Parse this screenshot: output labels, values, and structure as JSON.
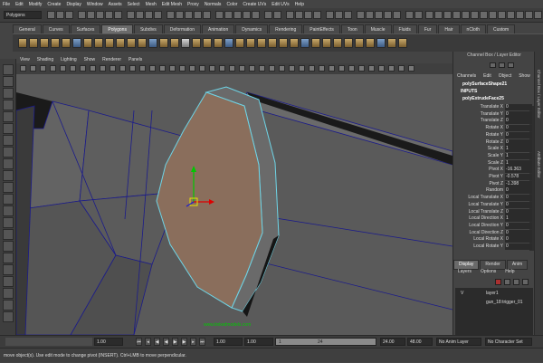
{
  "menubar": {
    "items": [
      "File",
      "Edit",
      "Modify",
      "Create",
      "Display",
      "Window",
      "Assets",
      "Select",
      "Mesh",
      "Edit Mesh",
      "Proxy",
      "Normals",
      "Color",
      "Create UVs",
      "Edit UVs",
      "Help"
    ]
  },
  "statusline": {
    "mode": "Polygons"
  },
  "shelf": {
    "tabs": [
      "General",
      "Curves",
      "Surfaces",
      "Polygons",
      "Subdivs",
      "Deformation",
      "Animation",
      "Dynamics",
      "Rendering",
      "PaintEffects",
      "Toon",
      "Muscle",
      "Fluids",
      "Fur",
      "Hair",
      "nCloth",
      "Custom"
    ],
    "active_tab": "Polygons"
  },
  "viewport": {
    "menu": [
      "View",
      "Shading",
      "Lighting",
      "Show",
      "Renderer",
      "Panels"
    ],
    "watermark": "www.tinkedmodels.com"
  },
  "channel_box": {
    "title": "Channel Box / Layer Editor",
    "menu": [
      "Channels",
      "Edit",
      "Object",
      "Show"
    ],
    "object_name": "polySurfaceShape21",
    "inputs_label": "INPUTS",
    "node_name": "polyExtrudeFace25",
    "attributes": [
      {
        "label": "Translate X",
        "value": "0"
      },
      {
        "label": "Translate Y",
        "value": "0"
      },
      {
        "label": "Translate Z",
        "value": "0"
      },
      {
        "label": "Rotate X",
        "value": "0"
      },
      {
        "label": "Rotate Y",
        "value": "0"
      },
      {
        "label": "Rotate Z",
        "value": "0"
      },
      {
        "label": "Scale X",
        "value": "1"
      },
      {
        "label": "Scale Y",
        "value": "1"
      },
      {
        "label": "Scale Z",
        "value": "1"
      },
      {
        "label": "Pivot X",
        "value": "-16.363"
      },
      {
        "label": "Pivot Y",
        "value": "-0.578"
      },
      {
        "label": "Pivot Z",
        "value": "-1.398"
      },
      {
        "label": "Random",
        "value": "0"
      },
      {
        "label": "Local Translate X",
        "value": "0"
      },
      {
        "label": "Local Translate Y",
        "value": "0"
      },
      {
        "label": "Local Translate Z",
        "value": "0"
      },
      {
        "label": "Local Direction X",
        "value": "1"
      },
      {
        "label": "Local Direction Y",
        "value": "0"
      },
      {
        "label": "Local Direction Z",
        "value": "0"
      },
      {
        "label": "Local Rotate X",
        "value": "0"
      },
      {
        "label": "Local Rotate Y",
        "value": "0"
      }
    ],
    "side_tabs": [
      "Channel Box / Layer Editor",
      "Attribute Editor"
    ]
  },
  "layer_editor": {
    "tabs": [
      "Display",
      "Render",
      "Anim"
    ],
    "active_tab": "Display",
    "menu": [
      "Layers",
      "Options",
      "Help"
    ],
    "layers": [
      {
        "visible": "V",
        "name": "layer1"
      },
      {
        "visible": "",
        "name": "gun_18:trigger_01"
      }
    ]
  },
  "timeline": {
    "start_time": "1.00",
    "current_time": "1.00",
    "range_start": "1.00",
    "range_current": "1",
    "range_end_marker": "24",
    "end_time": "24.00",
    "max_time": "48.00",
    "anim_layer": "No Anim Layer",
    "char_set": "No Character Set"
  },
  "helpline": {
    "text": "move object(s). Use edit mode to change pivot (INSERT). Ctrl+LMB to move perpendicular."
  },
  "colors": {
    "face_fill": "#8a6e5c",
    "wire": "#1b1b8a",
    "selection": "#6ed4e6",
    "bg": "#5a5a5a"
  }
}
